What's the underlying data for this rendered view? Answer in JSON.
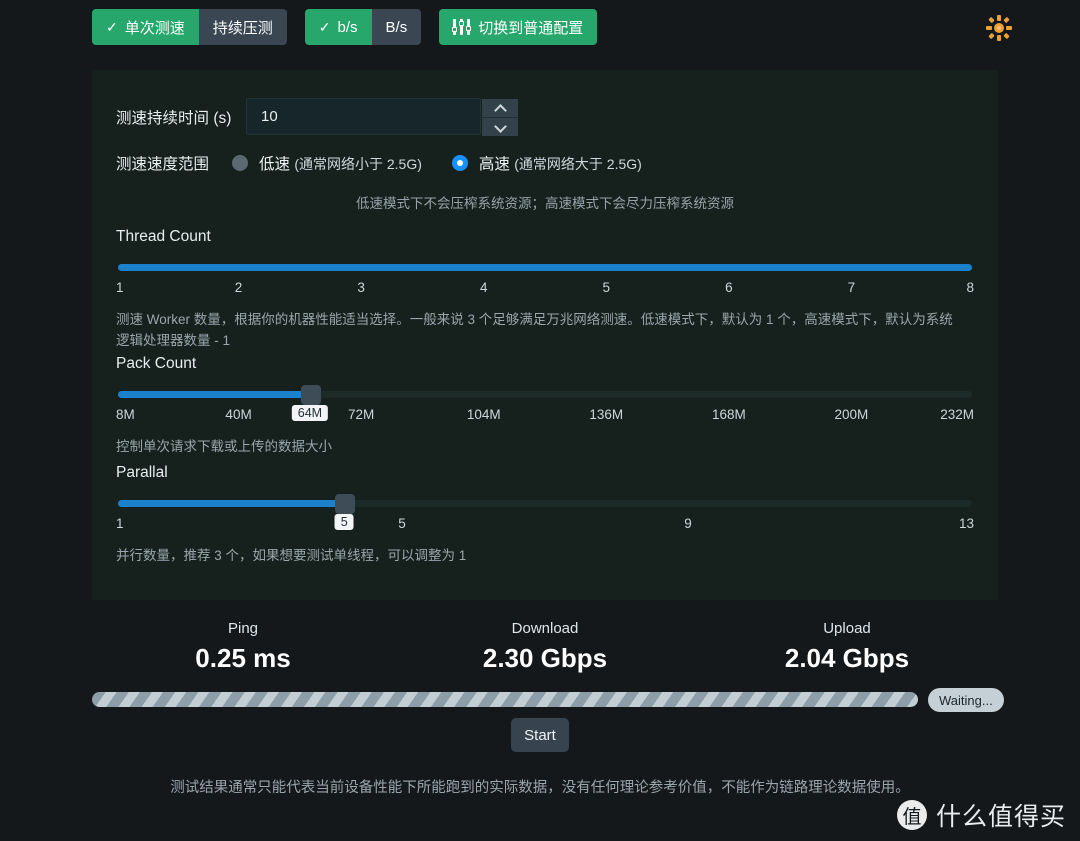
{
  "toolbar": {
    "mode_group": [
      {
        "label": "单次测速",
        "active": true,
        "icon": "check-icon"
      },
      {
        "label": "持续压测",
        "active": false
      }
    ],
    "unit_group": [
      {
        "label": "b/s",
        "active": true,
        "icon": "check-icon"
      },
      {
        "label": "B/s",
        "active": false
      }
    ],
    "switch_config": {
      "label": "切换到普通配置",
      "icon": "sliders-icon"
    },
    "theme_toggle": {
      "icon": "sun-icon",
      "color": "#f0a030"
    }
  },
  "settings": {
    "duration": {
      "label": "测速持续时间",
      "unit": "(s)",
      "value": "10",
      "placeholder": "10"
    },
    "speed_range": {
      "label": "测速速度范围",
      "options": [
        {
          "name": "低速",
          "note": "(通常网络小于 2.5G)",
          "selected": false
        },
        {
          "name": "高速",
          "note": "(通常网络大于 2.5G)",
          "selected": true
        }
      ],
      "hint": "低速模式下不会压榨系统资源；高速模式下会尽力压榨系统资源"
    },
    "thread_count": {
      "title": "Thread Count",
      "value": 8,
      "min": 1,
      "max": 8,
      "ticks": [
        "1",
        "2",
        "3",
        "4",
        "5",
        "6",
        "7",
        "8"
      ],
      "tooltip": null,
      "desc": "测速 Worker 数量，根据你的机器性能适当选择。一般来说 3 个足够满足万兆网络测速。低速模式下，默认为 1 个，高速模式下，默认为系统逻辑处理器数量 - 1"
    },
    "pack_count": {
      "title": "Pack Count",
      "value": 64,
      "min": 8,
      "max": 256,
      "ticks": [
        "8M",
        "40M",
        "72M",
        "104M",
        "136M",
        "168M",
        "200M",
        "232M"
      ],
      "tooltip": "64M",
      "desc": "控制单次请求下载或上传的数据大小"
    },
    "parallel": {
      "title": "Parallal",
      "value": 5,
      "min": 1,
      "max": 16,
      "ticks": [
        "1",
        "5",
        "9",
        "13"
      ],
      "tooltip": "5",
      "desc": "并行数量，推荐 3 个，如果想要测试单线程，可以调整为 1"
    }
  },
  "results": {
    "metrics": [
      {
        "label": "Ping",
        "value": "0.25 ms"
      },
      {
        "label": "Download",
        "value": "2.30 Gbps"
      },
      {
        "label": "Upload",
        "value": "2.04 Gbps"
      }
    ],
    "status_badge": "Waiting...",
    "progress_percent": 100,
    "start_button": "Start"
  },
  "footer": {
    "disclaimer": "测试结果通常只能代表当前设备性能下所能跑到的实际数据，没有任何理论参考价值，不能作为链路理论数据使用。"
  },
  "watermark": {
    "badge": "值",
    "text": "什么值得买"
  }
}
